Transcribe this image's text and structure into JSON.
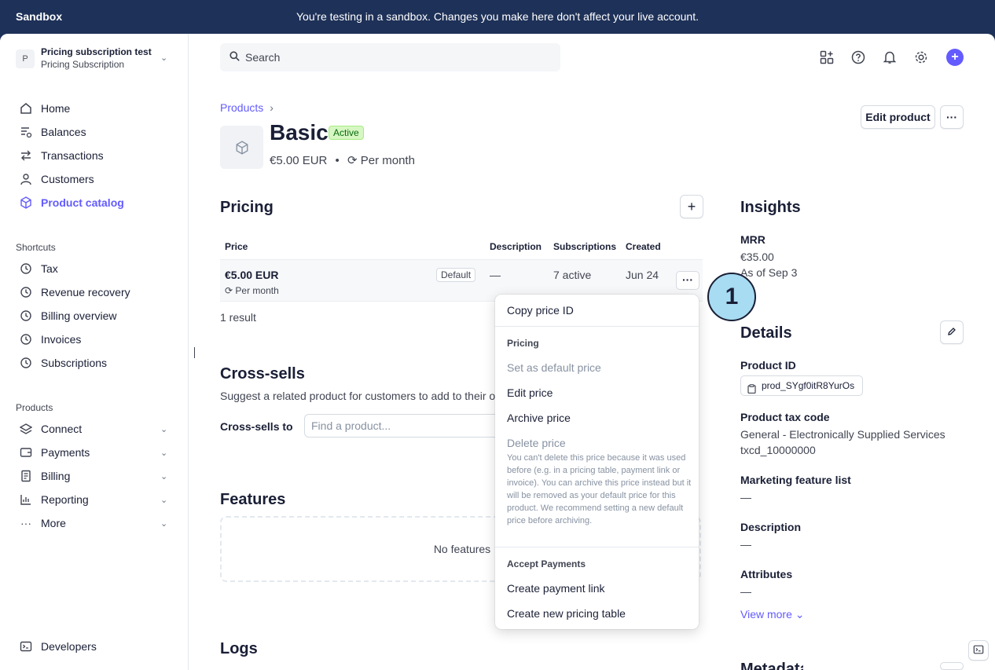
{
  "banner": {
    "brand": "Sandbox",
    "message": "You're testing in a sandbox. Changes you make here don't affect your live account."
  },
  "account": {
    "avatar": "P",
    "name": "Pricing subscription test",
    "subtitle": "Pricing Subscription"
  },
  "nav": {
    "main": [
      {
        "label": "Home",
        "icon": "home-icon"
      },
      {
        "label": "Balances",
        "icon": "balances-icon"
      },
      {
        "label": "Transactions",
        "icon": "arrows-icon"
      },
      {
        "label": "Customers",
        "icon": "person-icon"
      },
      {
        "label": "Product catalog",
        "icon": "cube-icon",
        "active": true
      }
    ],
    "shortcuts_heading": "Shortcuts",
    "shortcuts": [
      "Tax",
      "Revenue recovery",
      "Billing overview",
      "Invoices",
      "Subscriptions"
    ],
    "products_heading": "Products",
    "products": [
      "Connect",
      "Payments",
      "Billing",
      "Reporting",
      "More"
    ],
    "developers": "Developers"
  },
  "search": {
    "placeholder": "Search"
  },
  "breadcrumb": {
    "label": "Products"
  },
  "product": {
    "title": "Basic",
    "status": "Active",
    "price": "€5.00 EUR",
    "interval": "Per month",
    "edit_button": "Edit product"
  },
  "pricing": {
    "heading": "Pricing",
    "columns": [
      "Price",
      "Description",
      "Subscriptions",
      "Created"
    ],
    "row": {
      "price": "€5.00 EUR",
      "interval": "Per month",
      "badge": "Default",
      "description": "—",
      "subscriptions": "7 active",
      "created": "Jun 24"
    },
    "result_count": "1 result"
  },
  "cross_sells": {
    "heading": "Cross-sells",
    "subtitle": "Suggest a related product for customers to add to their o",
    "field_label": "Cross-sells to",
    "placeholder": "Find a product..."
  },
  "features": {
    "heading": "Features",
    "empty": "No features"
  },
  "logs": {
    "heading": "Logs"
  },
  "insights": {
    "heading": "Insights",
    "mrr_label": "MRR",
    "mrr_value": "€35.00",
    "as_of": "As of Sep 3"
  },
  "details": {
    "heading": "Details",
    "product_id_label": "Product ID",
    "product_id": "prod_SYgf0itR8YurOs",
    "tax_code_label": "Product tax code",
    "tax_code_name": "General - Electronically Supplied Services",
    "tax_code_id": "txcd_10000000",
    "marketing_label": "Marketing feature list",
    "marketing_value": "—",
    "description_label": "Description",
    "description_value": "—",
    "attributes_label": "Attributes",
    "attributes_value": "—",
    "view_more": "View more"
  },
  "metadata": {
    "heading": "Metadata"
  },
  "menu": {
    "copy_price_id": "Copy price ID",
    "pricing_heading": "Pricing",
    "set_default": "Set as default price",
    "edit_price": "Edit price",
    "archive_price": "Archive price",
    "delete_price": "Delete price",
    "delete_note": "You can't delete this price because it was used before (e.g. in a pricing table, payment link or invoice). You can archive this price instead but it will be removed as your default price for this product. We recommend setting a new default price before archiving.",
    "payments_heading": "Accept Payments",
    "create_payment_link": "Create payment link",
    "create_pricing_table": "Create new pricing table"
  },
  "step_marker": "1"
}
